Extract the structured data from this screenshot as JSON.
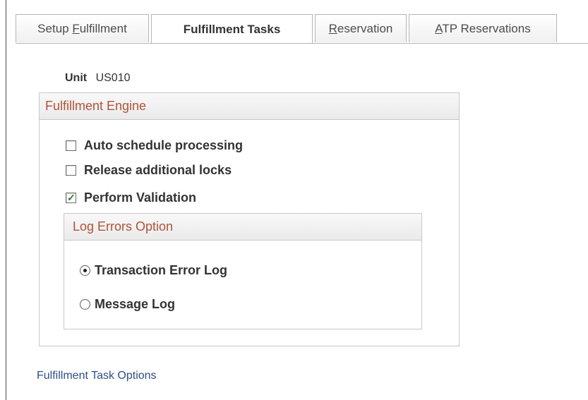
{
  "tabs": [
    {
      "pre": "Setup ",
      "ul": "F",
      "post": "ulfillment"
    },
    {
      "pre": "Fulfillment Tasks",
      "ul": "",
      "post": ""
    },
    {
      "pre": "",
      "ul": "R",
      "post": "eservation"
    },
    {
      "pre": "",
      "ul": "A",
      "post": "TP Reservations"
    }
  ],
  "active_tab": "Fulfillment Tasks",
  "unit": {
    "label": "Unit",
    "value": "US010"
  },
  "engine": {
    "title": "Fulfillment Engine",
    "options": [
      {
        "label": "Auto schedule processing",
        "checked": false
      },
      {
        "label": "Release additional locks",
        "checked": false
      },
      {
        "label": "Perform Validation",
        "checked": true
      }
    ]
  },
  "log_errors": {
    "title": "Log Errors Option",
    "options": [
      {
        "label": "Transaction Error Log",
        "selected": true
      },
      {
        "label": "Message Log",
        "selected": false
      }
    ]
  },
  "footer_link": "Fulfillment Task Options",
  "colors": {
    "group_title": "#b0533a",
    "link": "#2d4f8e",
    "check": "#2a7a2a"
  }
}
